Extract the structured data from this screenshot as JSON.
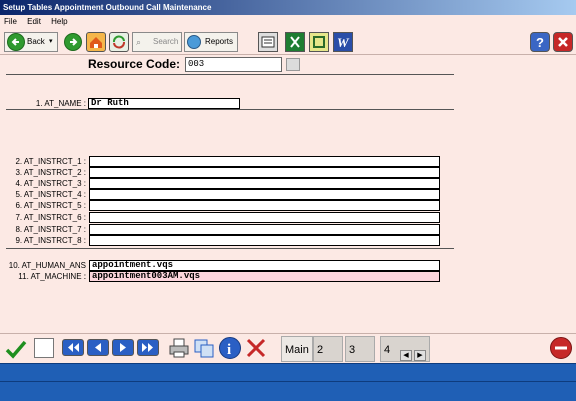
{
  "window": {
    "title": "Setup Tables  Appointment Outbound Call Maintenance"
  },
  "menu": [
    "File",
    "Edit",
    "Help"
  ],
  "toolbar": {
    "back_label": "Back",
    "search_label": "Search",
    "reports_label": "Reports"
  },
  "resource": {
    "label": "Resource Code:",
    "value": "003"
  },
  "fields": {
    "at_name": {
      "label": "1. AT_NAME :",
      "value": "Dr Ruth"
    },
    "instructions": [
      {
        "label": "2. AT_INSTRCT_1 :",
        "value": ""
      },
      {
        "label": "3. AT_INSTRCT_2 :",
        "value": ""
      },
      {
        "label": "4. AT_INSTRCT_3 :",
        "value": ""
      },
      {
        "label": "5. AT_INSTRCT_4 :",
        "value": ""
      },
      {
        "label": "6. AT_INSTRCT_5 :",
        "value": ""
      },
      {
        "label": "7. AT_INSTRCT_6 :",
        "value": ""
      },
      {
        "label": "8. AT_INSTRCT_7 :",
        "value": ""
      },
      {
        "label": "9. AT_INSTRCT_8 :",
        "value": ""
      }
    ],
    "human_ans": {
      "label": "10. AT_HUMAN_ANS :",
      "value": "appointment.vqs"
    },
    "machine": {
      "label": "11. AT_MACHINE :",
      "value": "appointment003AM.vqs"
    }
  },
  "tabs": [
    "Main",
    "2",
    "3",
    "4"
  ],
  "colors": {
    "background": "#fce9e4",
    "title_bar": "#0a246a",
    "status_bar": "#1f5fb5",
    "focused_field": "#fcd5dc"
  },
  "icons": [
    "back-arrow-icon",
    "forward-arrow-icon",
    "home-icon",
    "refresh-icon",
    "search-icon",
    "reports-icon",
    "fax-icon",
    "excel-icon",
    "publisher-icon",
    "word-icon",
    "help-icon",
    "close-icon",
    "check-icon",
    "first-record-icon",
    "previous-record-icon",
    "next-record-icon",
    "last-record-icon",
    "print-icon",
    "copy-icon",
    "info-icon",
    "delete-icon",
    "exit-icon"
  ]
}
